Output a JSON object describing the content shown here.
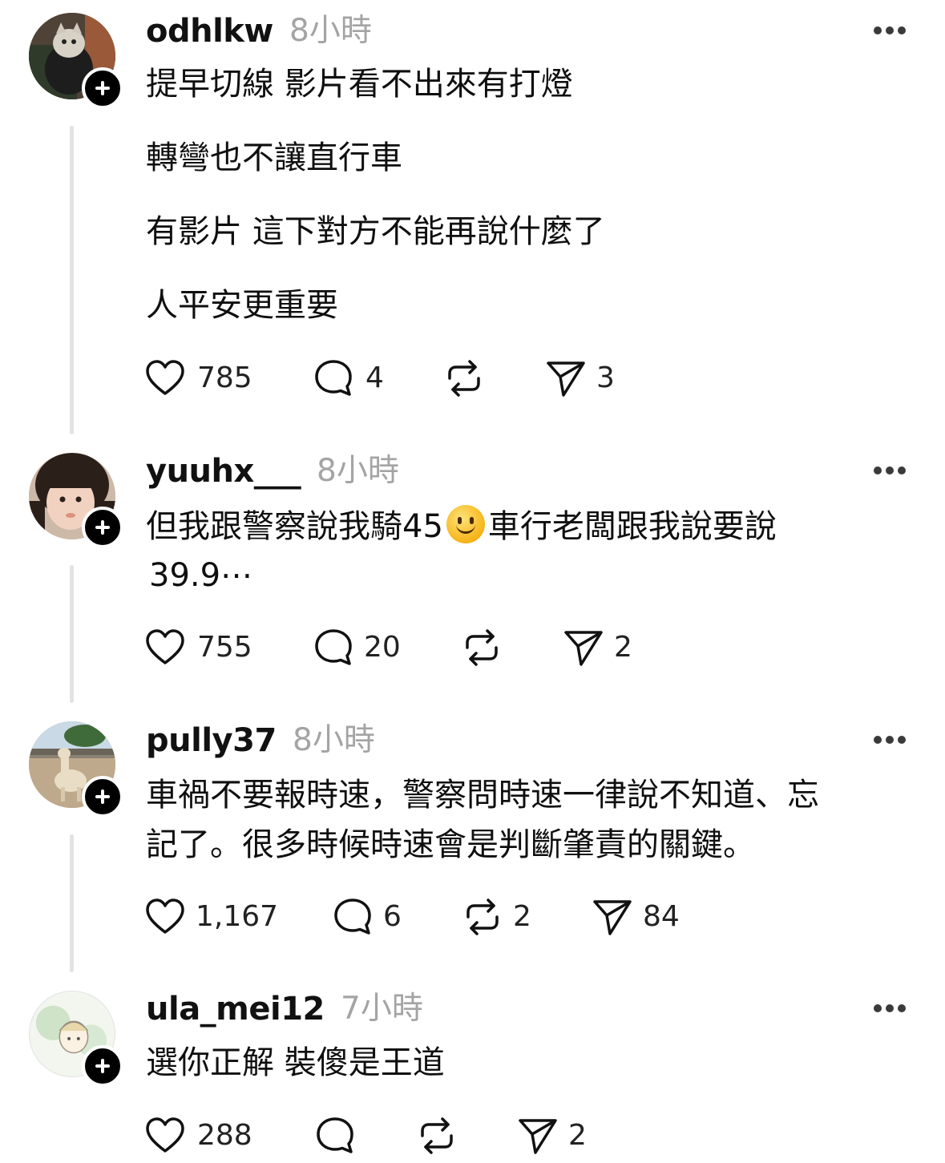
{
  "posts": [
    {
      "username": "odhlkw",
      "time": "8小時",
      "lines": [
        "提早切線 影片看不出來有打燈",
        "轉彎也不讓直行車",
        "有影片 這下對方不能再說什麼了",
        "人平安更重要"
      ],
      "likes": "785",
      "replies": "4",
      "reposts": "",
      "shares": "3"
    },
    {
      "username": "yuuhx___",
      "time": "8小時",
      "line1_before": "但我跟警察說我騎45",
      "emoji": "slightly-smiling-face",
      "line1_after": "車行老闆跟我說要說",
      "line2": "39.9⋯",
      "likes": "755",
      "replies": "20",
      "reposts": "",
      "shares": "2"
    },
    {
      "username": "pully37",
      "time": "8小時",
      "lines": [
        "車禍不要報時速，警察問時速一律說不知道、忘",
        "記了。很多時候時速會是判斷肇責的關鍵。"
      ],
      "likes": "1,167",
      "replies": "6",
      "reposts": "2",
      "shares": "84"
    },
    {
      "username": "ula_mei12",
      "time": "7小時",
      "lines": [
        "選你正解 裝傻是王道"
      ],
      "likes": "288",
      "replies": "",
      "reposts": "",
      "shares": "2"
    }
  ],
  "icons": {
    "like": "heart-icon",
    "reply": "comment-icon",
    "repost": "repost-icon",
    "share": "send-icon",
    "more": "more-options-icon",
    "follow": "follow-plus-icon"
  }
}
